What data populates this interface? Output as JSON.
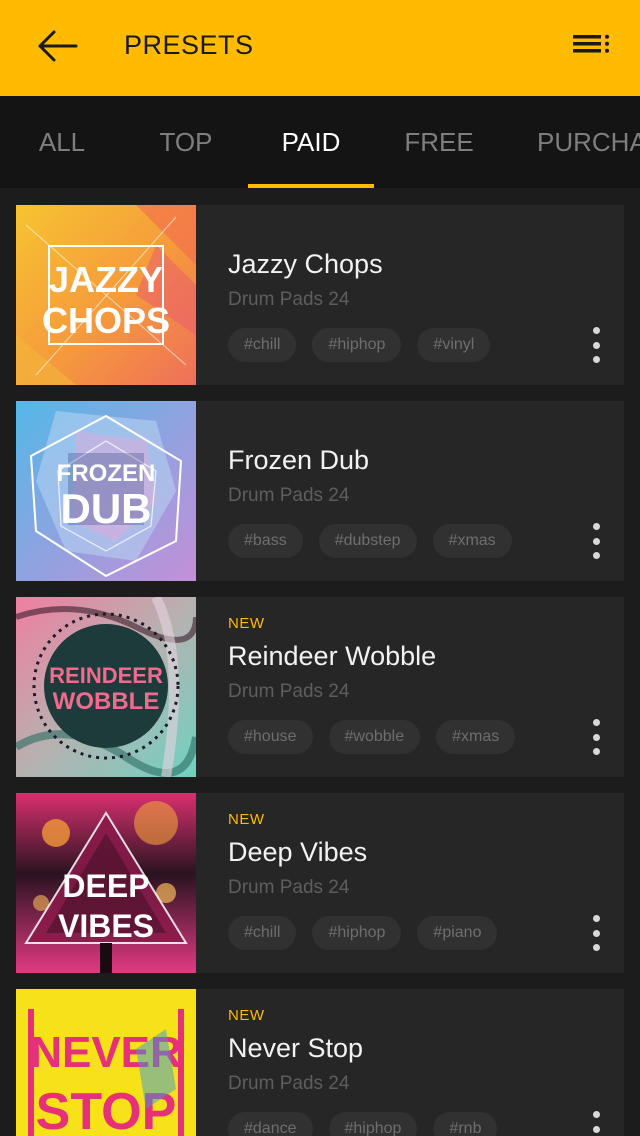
{
  "header": {
    "title": "PRESETS",
    "accent_color": "#ffbb00",
    "back_icon": "arrow-left-icon",
    "menu_icon": "menu-list-icon"
  },
  "tabs": [
    {
      "label": "ALL",
      "active": false
    },
    {
      "label": "TOP",
      "active": false
    },
    {
      "label": "PAID",
      "active": true
    },
    {
      "label": "FREE",
      "active": false
    },
    {
      "label": "PURCHA",
      "active": false
    }
  ],
  "presets": [
    {
      "new_label": "",
      "name": "Jazzy Chops",
      "subtitle": "Drum Pads 24",
      "tags": [
        "#chill",
        "#hiphop",
        "#vinyl"
      ],
      "cover_line1": "JAZZY",
      "cover_line2": "CHOPS",
      "selected": true
    },
    {
      "new_label": "",
      "name": "Frozen Dub",
      "subtitle": "Drum Pads 24",
      "tags": [
        "#bass",
        "#dubstep",
        "#xmas"
      ],
      "cover_line1": "FROZEN",
      "cover_line2": "DUB",
      "selected": false
    },
    {
      "new_label": "NEW",
      "name": "Reindeer Wobble",
      "subtitle": "Drum Pads 24",
      "tags": [
        "#house",
        "#wobble",
        "#xmas"
      ],
      "cover_line1": "REINDEER",
      "cover_line2": "WOBBLE",
      "selected": false
    },
    {
      "new_label": "NEW",
      "name": "Deep Vibes",
      "subtitle": "Drum Pads 24",
      "tags": [
        "#chill",
        "#hiphop",
        "#piano"
      ],
      "cover_line1": "DEEP",
      "cover_line2": "VIBES",
      "selected": false
    },
    {
      "new_label": "NEW",
      "name": "Never Stop",
      "subtitle": "Drum Pads 24",
      "tags": [
        "#dance",
        "#hiphop",
        "#rnb"
      ],
      "cover_line1": "NEVER",
      "cover_line2": "STOP",
      "selected": false
    }
  ]
}
